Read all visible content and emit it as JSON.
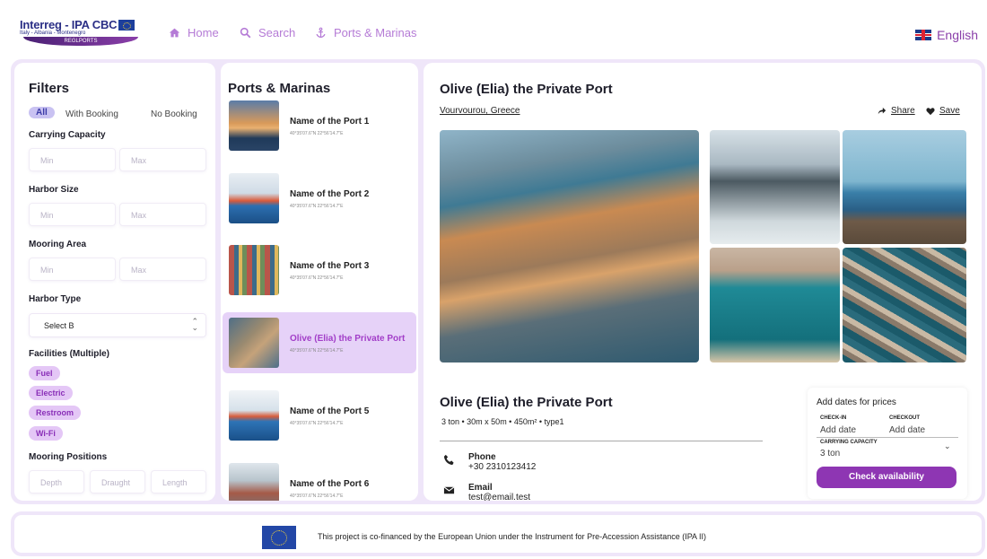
{
  "header": {
    "logo": {
      "title": "Interreg - IPA CBC",
      "subtitle": "Italy - Albania - Montenegro",
      "ribbon": "REGLPORTS"
    },
    "nav": [
      {
        "label": "Home",
        "icon": "home-icon"
      },
      {
        "label": "Search",
        "icon": "search-icon"
      },
      {
        "label": "Ports & Marinas",
        "icon": "anchor-icon"
      }
    ],
    "language": "English"
  },
  "filters": {
    "title": "Filters",
    "booking_options": [
      "All",
      "With Booking",
      "No Booking"
    ],
    "carrying_capacity": {
      "label": "Carrying Capacity",
      "min_placeholder": "Min",
      "max_placeholder": "Max"
    },
    "harbor_size": {
      "label": "Harbor Size",
      "min_placeholder": "Min",
      "max_placeholder": "Max"
    },
    "mooring_area": {
      "label": "Mooring Area",
      "min_placeholder": "Min",
      "max_placeholder": "Max"
    },
    "harbor_type": {
      "label": "Harbor Type",
      "value": "Select B"
    },
    "facilities": {
      "label": "Facilities (Multiple)",
      "items": [
        "Fuel",
        "Electric",
        "Restroom",
        "Wi-Fi"
      ]
    },
    "mooring_positions": {
      "label": "Mooring Positions",
      "placeholders": [
        "Depth",
        "Draught",
        "Length"
      ]
    }
  },
  "ports": {
    "title": "Ports & Marinas",
    "items": [
      {
        "name": "Name of the Port 1",
        "coords": "40°35'07.6\"N 22°56'14.7\"E"
      },
      {
        "name": "Name of the Port 2",
        "coords": "40°35'07.6\"N 22°56'14.7\"E"
      },
      {
        "name": "Name of the Port 3",
        "coords": "40°35'07.6\"N 22°56'14.7\"E"
      },
      {
        "name": "Olive (Elia) the Private Port",
        "coords": "40°35'07.6\"N 22°56'14.7\"E"
      },
      {
        "name": "Name of the Port 5",
        "coords": "40°35'07.6\"N 22°56'14.7\"E"
      },
      {
        "name": "Name of the Port 6",
        "coords": "40°35'07.6\"N 22°56'14.7\"E"
      }
    ]
  },
  "detail": {
    "title": "Olive (Elia) the Private Port",
    "location": "Vourvourou, Greece",
    "share": "Share",
    "save": "Save",
    "subtitle": "Olive (Elia) the Private Port",
    "specs": "3 ton • 30m x 50m • 450m² • type1",
    "phone": {
      "label": "Phone",
      "value": "+30 2310123412"
    },
    "email": {
      "label": "Email",
      "value": "test@email.test"
    }
  },
  "booking_card": {
    "title": "Add dates for prices",
    "checkin_label": "CHECK-IN",
    "checkin_value": "Add date",
    "checkout_label": "CHECKOUT",
    "checkout_value": "Add date",
    "capacity_label": "CARRYING CAPACITY",
    "capacity_value": "3 ton",
    "button": "Check availability"
  },
  "footer": {
    "text": "This project is co-financed by the European Union under the Instrument for Pre-Accession Assistance (IPA II)"
  },
  "colors": {
    "accent": "#8e36b3",
    "nav": "#b57bd6",
    "frame": "#efe6f9",
    "active_item": "#e6d2f8",
    "fac_pill": "#e4c7f6"
  }
}
